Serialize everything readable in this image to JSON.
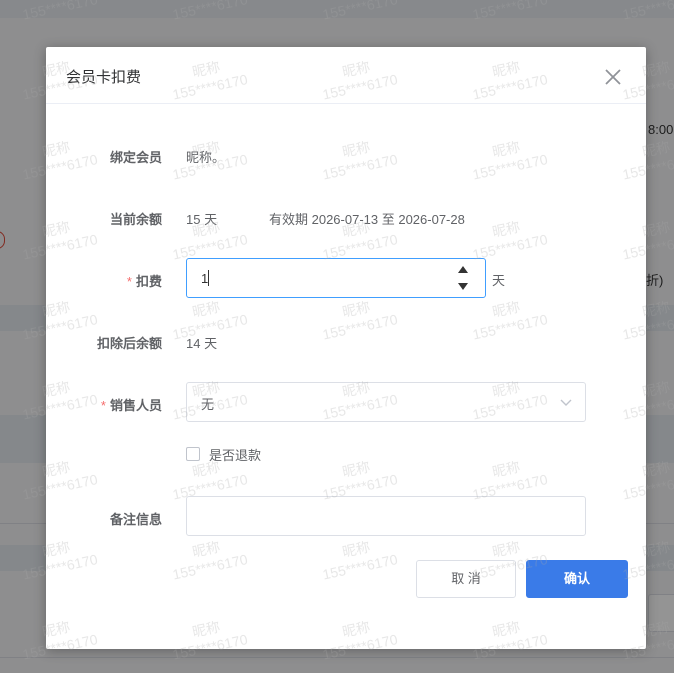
{
  "background": {
    "right_time": "8:00",
    "right_paren": "折)"
  },
  "dialog": {
    "title": "会员卡扣费",
    "close_icon": "close-icon",
    "fields": {
      "member": {
        "label": "绑定会员",
        "value": "昵称。"
      },
      "balance": {
        "label": "当前余额",
        "value": "15 天",
        "validity": "有效期 2026-07-13 至 2026-07-28"
      },
      "deduct": {
        "required_mark": "*",
        "label": "扣费",
        "value": "1",
        "unit": "天"
      },
      "remaining": {
        "label": "扣除后余额",
        "value": "14 天"
      },
      "sales": {
        "required_mark": "*",
        "label": "销售人员",
        "selected": "无"
      },
      "refund": {
        "label": "是否退款",
        "checked": false
      },
      "remark": {
        "label": "备注信息",
        "value": "",
        "placeholder": ""
      }
    },
    "buttons": {
      "cancel": "取 消",
      "confirm": "确认"
    }
  },
  "watermark": {
    "line1": "昵称",
    "line2": "155****6170"
  },
  "colors": {
    "primary": "#3a7be8",
    "required": "#f56c6c",
    "focus_border": "#409eff"
  }
}
